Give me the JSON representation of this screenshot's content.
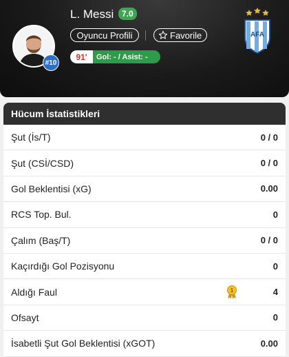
{
  "player": {
    "name": "L. Messi",
    "rating": "7.0",
    "shirt_number": "#10",
    "profile_button": "Oyuncu Profili",
    "favorite_button": "Favorile",
    "minute": "91'",
    "goal_assist": "Gol: - / Asist: -"
  },
  "colors": {
    "rating": "#3ea555",
    "minute_text": "#d32f2f",
    "goals_bg": "#2e9b4a",
    "card_header": "#2f2f2f"
  },
  "stats": {
    "title": "Hücum İstatistikleri",
    "rows": [
      {
        "label": "Şut (İs/T)",
        "value": "0 / 0"
      },
      {
        "label": "Şut (CSİ/CSD)",
        "value": "0 / 0"
      },
      {
        "label": "Gol Beklentisi (xG)",
        "value": "0.00"
      },
      {
        "label": "RCS Top. Bul.",
        "value": "0"
      },
      {
        "label": "Çalım (Baş/T)",
        "value": "0 / 0"
      },
      {
        "label": "Kaçırdığı Gol Pozisyonu",
        "value": "0"
      },
      {
        "label": "Aldığı Faul",
        "value": "4",
        "icon": "gold-medal-icon",
        "medal_number": "1"
      },
      {
        "label": "Ofsayt",
        "value": "0"
      },
      {
        "label": "İsabetli Şut Gol Beklentisi (xGOT)",
        "value": "0.00"
      }
    ]
  }
}
